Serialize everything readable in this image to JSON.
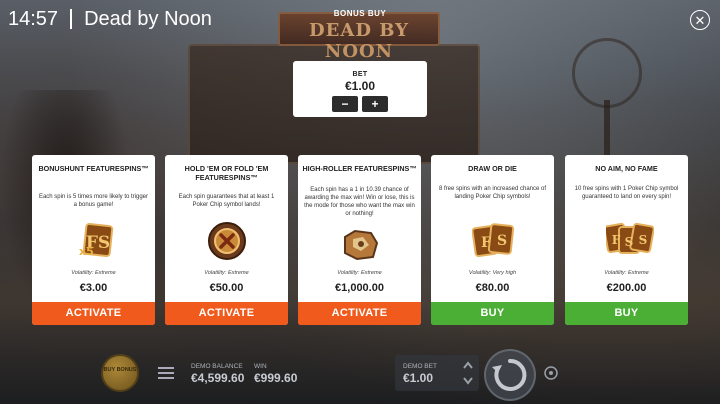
{
  "status_bar": {
    "time": "14:57",
    "game_title": "Dead by Noon"
  },
  "header": {
    "title": "BONUS BUY",
    "close_icon": "close-icon"
  },
  "background": {
    "logo_text": "DEAD BY NOON"
  },
  "bet": {
    "label": "BET",
    "value": "€1.00",
    "minus": "−",
    "plus": "+"
  },
  "cards": [
    {
      "title": "BONUSHUNT FEATURESPINS™",
      "description": "Each spin is 5 times more likely to trigger a bonus game!",
      "icon": "fs-x5-icon",
      "volatility": "Volatility: Extreme",
      "price": "€3.00",
      "button": "ACTIVATE",
      "button_color": "#f05a1c"
    },
    {
      "title": "HOLD 'EM OR FOLD 'EM FEATURESPINS™",
      "description": "Each spin guarantees that at least 1 Poker Chip symbol lands!",
      "icon": "poker-chip-icon",
      "volatility": "Volatility: Extreme",
      "price": "€50.00",
      "button": "ACTIVATE",
      "button_color": "#f05a1c"
    },
    {
      "title": "HIGH-ROLLER FEATURESPINS™",
      "description": "Each spin has a 1 in 10.39 chance of awarding the max win! Win or lose, this is the mode for those who want the max win or nothing!",
      "icon": "gold-nugget-icon",
      "volatility": "Volatility: Extreme",
      "price": "€1,000.00",
      "button": "ACTIVATE",
      "button_color": "#f05a1c"
    },
    {
      "title": "DRAW OR DIE",
      "description": "8 free spins with an increased chance of landing Poker Chip symbols!",
      "icon": "fs-cards-icon",
      "volatility": "Volatility: Very high",
      "price": "€80.00",
      "button": "BUY",
      "button_color": "#4caf35"
    },
    {
      "title": "NO AIM, NO FAME",
      "description": "10 free spins with 1 Poker Chip symbol guaranteed to land on every spin!",
      "icon": "fs-cards-stack-icon",
      "volatility": "Volatility: Extreme",
      "price": "€200.00",
      "button": "BUY",
      "button_color": "#4caf35"
    }
  ],
  "bottom_bar": {
    "buy_bonus": "BUY BONUS",
    "demo_balance_label": "DEMO BALANCE",
    "demo_balance_value": "€4,599.60",
    "win_label": "WIN",
    "win_value": "€999.60",
    "demo_bet_label": "DEMO BET",
    "demo_bet_value": "€1.00"
  },
  "colors": {
    "activate": "#f05a1c",
    "buy": "#4caf35",
    "card_bg": "#ffffff"
  }
}
